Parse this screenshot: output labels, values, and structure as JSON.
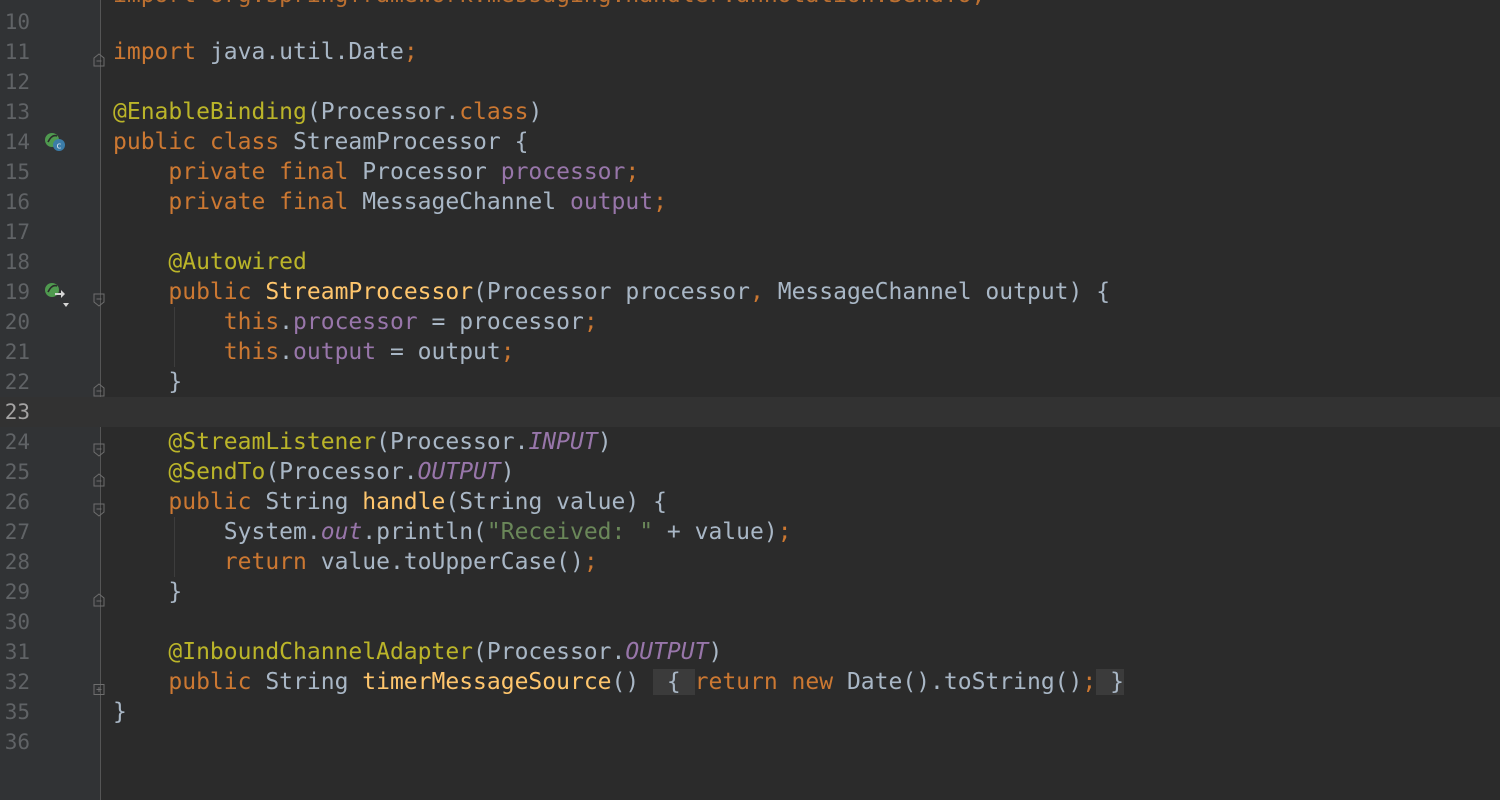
{
  "editor": {
    "current_line": "23",
    "top_partial_text": "import org.springframework.messaging.handler.annotation.SendTo;",
    "lines": [
      {
        "num": "10",
        "y": 0
      },
      {
        "num": "11",
        "tokens": [
          [
            "k",
            "import"
          ],
          [
            "p",
            " java.util.Date"
          ],
          [
            "k",
            ";"
          ]
        ]
      },
      {
        "num": "12"
      },
      {
        "num": "13",
        "tokens": [
          [
            "an",
            "@EnableBinding"
          ],
          [
            "p",
            "(Processor."
          ],
          [
            "k",
            "class"
          ],
          [
            "p",
            ")"
          ]
        ]
      },
      {
        "num": "14",
        "tokens": [
          [
            "k",
            "public class"
          ],
          [
            "p",
            " StreamProcessor {"
          ]
        ]
      },
      {
        "num": "15",
        "tokens": [
          [
            "p",
            "    "
          ],
          [
            "k",
            "private final"
          ],
          [
            "p",
            " Processor "
          ],
          [
            "f",
            "processor"
          ],
          [
            "k",
            ";"
          ]
        ]
      },
      {
        "num": "16",
        "tokens": [
          [
            "p",
            "    "
          ],
          [
            "k",
            "private final"
          ],
          [
            "p",
            " MessageChannel "
          ],
          [
            "f",
            "output"
          ],
          [
            "k",
            ";"
          ]
        ]
      },
      {
        "num": "17"
      },
      {
        "num": "18",
        "tokens": [
          [
            "p",
            "    "
          ],
          [
            "an",
            "@Autowired"
          ]
        ]
      },
      {
        "num": "19",
        "tokens": [
          [
            "p",
            "    "
          ],
          [
            "k",
            "public"
          ],
          [
            "p",
            " "
          ],
          [
            "fn",
            "StreamProcessor"
          ],
          [
            "p",
            "(Processor processor"
          ],
          [
            "k",
            ","
          ],
          [
            "p",
            " MessageChannel output) {"
          ]
        ]
      },
      {
        "num": "20",
        "tokens": [
          [
            "p",
            "        "
          ],
          [
            "k",
            "this"
          ],
          [
            "p",
            "."
          ],
          [
            "f",
            "processor"
          ],
          [
            "p",
            " = processor"
          ],
          [
            "k",
            ";"
          ]
        ]
      },
      {
        "num": "21",
        "tokens": [
          [
            "p",
            "        "
          ],
          [
            "k",
            "this"
          ],
          [
            "p",
            "."
          ],
          [
            "f",
            "output"
          ],
          [
            "p",
            " = output"
          ],
          [
            "k",
            ";"
          ]
        ]
      },
      {
        "num": "22",
        "tokens": [
          [
            "p",
            "    }"
          ]
        ]
      },
      {
        "num": "23"
      },
      {
        "num": "24",
        "tokens": [
          [
            "p",
            "    "
          ],
          [
            "an",
            "@StreamListener"
          ],
          [
            "p",
            "(Processor."
          ],
          [
            "sf",
            "INPUT"
          ],
          [
            "p",
            ")"
          ]
        ]
      },
      {
        "num": "25",
        "tokens": [
          [
            "p",
            "    "
          ],
          [
            "an",
            "@SendTo"
          ],
          [
            "p",
            "(Processor."
          ],
          [
            "sf",
            "OUTPUT"
          ],
          [
            "p",
            ")"
          ]
        ]
      },
      {
        "num": "26",
        "tokens": [
          [
            "p",
            "    "
          ],
          [
            "k",
            "public"
          ],
          [
            "p",
            " String "
          ],
          [
            "fn",
            "handle"
          ],
          [
            "p",
            "(String value) {"
          ]
        ]
      },
      {
        "num": "27",
        "tokens": [
          [
            "p",
            "        System."
          ],
          [
            "sf",
            "out"
          ],
          [
            "p",
            ".println("
          ],
          [
            "s",
            "\"Received: \""
          ],
          [
            "p",
            " + value)"
          ],
          [
            "k",
            ";"
          ]
        ]
      },
      {
        "num": "28",
        "tokens": [
          [
            "p",
            "        "
          ],
          [
            "k",
            "return"
          ],
          [
            "p",
            " value.toUpperCase()"
          ],
          [
            "k",
            ";"
          ]
        ]
      },
      {
        "num": "29",
        "tokens": [
          [
            "p",
            "    }"
          ]
        ]
      },
      {
        "num": "30"
      },
      {
        "num": "31",
        "tokens": [
          [
            "p",
            "    "
          ],
          [
            "an",
            "@InboundChannelAdapter"
          ],
          [
            "p",
            "(Processor."
          ],
          [
            "sf",
            "OUTPUT"
          ],
          [
            "p",
            ")"
          ]
        ]
      },
      {
        "num": "32",
        "tokens": [
          [
            "p",
            "    "
          ],
          [
            "k",
            "public"
          ],
          [
            "p",
            " String "
          ],
          [
            "fn",
            "timerMessageSource"
          ],
          [
            "p",
            "()"
          ],
          [
            "p",
            " "
          ],
          [
            "folded",
            " { "
          ],
          [
            "k",
            "return new"
          ],
          [
            "p",
            " Date().toString()"
          ],
          [
            "k",
            ";"
          ],
          [
            "folded",
            " }"
          ]
        ]
      },
      {
        "num": "35",
        "tokens": [
          [
            "p",
            "}"
          ]
        ]
      },
      {
        "num": "36"
      }
    ],
    "gutter_icons": [
      {
        "line": "14",
        "icon": "spring-bean-class-icon"
      },
      {
        "line": "19",
        "icon": "spring-autowired-navigation-icon"
      }
    ],
    "fold_markers": [
      {
        "line": "11",
        "type": "end"
      },
      {
        "line": "19",
        "type": "start"
      },
      {
        "line": "22",
        "type": "end"
      },
      {
        "line": "24",
        "type": "start"
      },
      {
        "line": "25",
        "type": "end"
      },
      {
        "line": "26",
        "type": "start"
      },
      {
        "line": "29",
        "type": "end"
      },
      {
        "line": "32",
        "type": "collapsed"
      }
    ],
    "colors": {
      "background": "#2b2b2b",
      "gutter": "#313335",
      "keyword": "#cc7832",
      "annotation": "#bbb529",
      "field": "#9876aa",
      "method_decl": "#ffc66d",
      "string": "#6a8759",
      "plain": "#a9b7c6",
      "line_number": "#606366"
    }
  }
}
